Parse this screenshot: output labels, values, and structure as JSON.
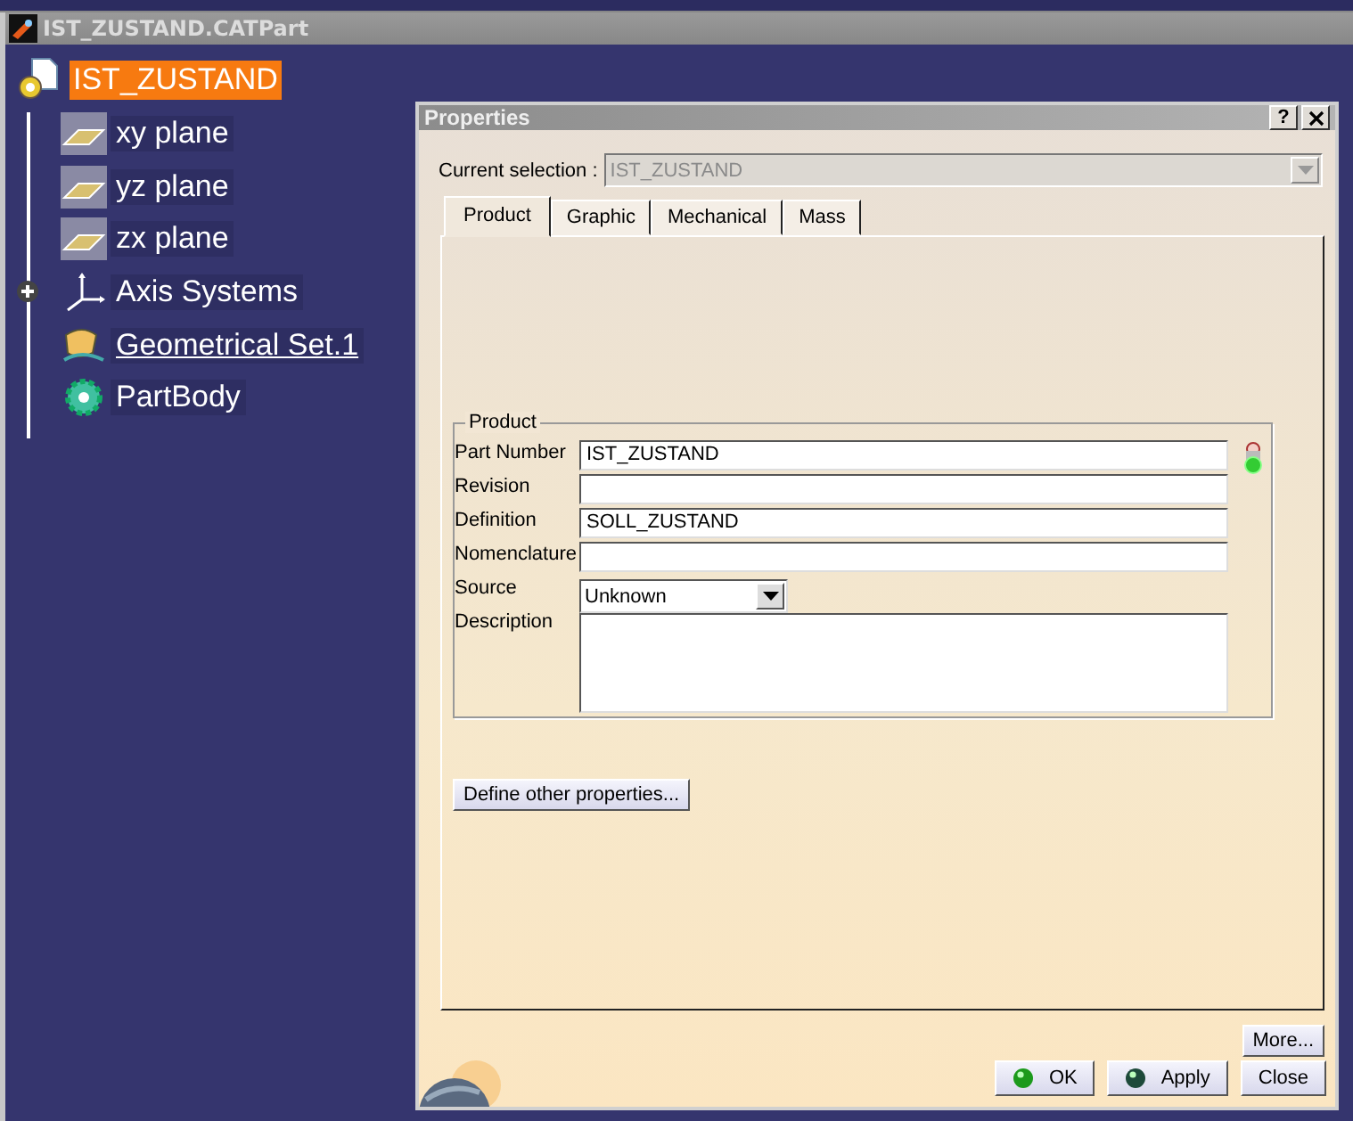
{
  "window": {
    "title": "IST_ZUSTAND.CATPart"
  },
  "tree": {
    "label": "IST_ZUSTAND",
    "selected": true,
    "children": [
      {
        "label": "xy plane",
        "kind": "plane",
        "collapsed": false,
        "in_work": false
      },
      {
        "label": "yz plane",
        "kind": "plane",
        "collapsed": false,
        "in_work": false
      },
      {
        "label": "zx plane",
        "kind": "plane",
        "collapsed": false,
        "in_work": false
      },
      {
        "label": "Axis Systems",
        "kind": "axis",
        "collapsed": true,
        "in_work": false
      },
      {
        "label": "Geometrical Set.1",
        "kind": "geoset",
        "collapsed": false,
        "in_work": true
      },
      {
        "label": "PartBody",
        "kind": "body",
        "collapsed": false,
        "in_work": false
      }
    ]
  },
  "dialog": {
    "title": "Properties",
    "help_button": "?",
    "current_selection": {
      "label": "Current selection :",
      "value": "IST_ZUSTAND",
      "disabled": true
    },
    "tabs": [
      {
        "label": "Product",
        "selected": true
      },
      {
        "label": "Graphic",
        "selected": false
      },
      {
        "label": "Mechanical",
        "selected": false
      },
      {
        "label": "Mass",
        "selected": false
      }
    ],
    "group": {
      "title": "Product",
      "fields": [
        {
          "label": "Part Number",
          "value": "IST_ZUSTAND",
          "kind": "text"
        },
        {
          "label": "Revision",
          "kind": "text"
        },
        {
          "label": "Definition",
          "value": "SOLL_ZUSTAND",
          "kind": "text"
        },
        {
          "label": "Nomenclature",
          "kind": "text"
        },
        {
          "label": "Source",
          "value": "Unknown",
          "kind": "dropdown"
        },
        {
          "label": "Description",
          "kind": "textarea"
        }
      ]
    },
    "define_button": "Define other properties...",
    "more_button": "More...",
    "buttons": [
      {
        "label": "OK",
        "kind": "ok"
      },
      {
        "label": "Apply",
        "kind": "apply"
      },
      {
        "label": "Close",
        "kind": "plain"
      }
    ]
  }
}
